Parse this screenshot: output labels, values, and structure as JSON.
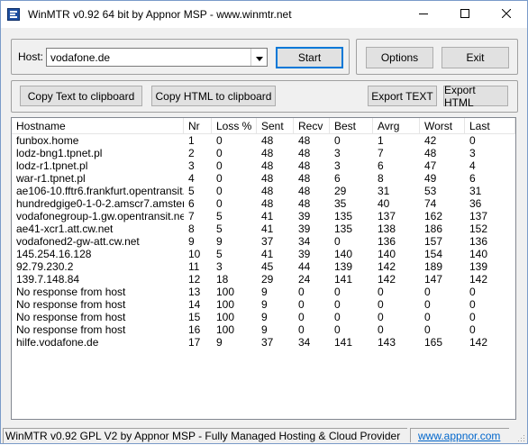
{
  "window": {
    "title": "WinMTR v0.92 64 bit by Appnor MSP - www.winmtr.net",
    "icon": "winmtr-app-icon",
    "controls": [
      "minimize-icon",
      "maximize-icon",
      "close-icon"
    ]
  },
  "host_group": {
    "label": "Host:",
    "value": "vodafone.de",
    "start_label": "Start"
  },
  "options_group": {
    "options_label": "Options",
    "exit_label": "Exit"
  },
  "toolbar": {
    "copy_text_label": "Copy Text to clipboard",
    "copy_html_label": "Copy HTML to clipboard",
    "export_text_label": "Export TEXT",
    "export_html_label": "Export HTML"
  },
  "table": {
    "columns": [
      "Hostname",
      "Nr",
      "Loss %",
      "Sent",
      "Recv",
      "Best",
      "Avrg",
      "Worst",
      "Last"
    ],
    "rows": [
      [
        "funbox.home",
        "1",
        "0",
        "48",
        "48",
        "0",
        "1",
        "42",
        "0"
      ],
      [
        "lodz-bng1.tpnet.pl",
        "2",
        "0",
        "48",
        "48",
        "3",
        "7",
        "48",
        "3"
      ],
      [
        "lodz-r1.tpnet.pl",
        "3",
        "0",
        "48",
        "48",
        "3",
        "6",
        "47",
        "4"
      ],
      [
        "war-r1.tpnet.pl",
        "4",
        "0",
        "48",
        "48",
        "6",
        "8",
        "49",
        "6"
      ],
      [
        "ae106-10.fftr6.frankfurt.opentransit.net",
        "5",
        "0",
        "48",
        "48",
        "29",
        "31",
        "53",
        "31"
      ],
      [
        "hundredgige0-1-0-2.amscr7.amsterda...",
        "6",
        "0",
        "48",
        "48",
        "35",
        "40",
        "74",
        "36"
      ],
      [
        "vodafonegroup-1.gw.opentransit.net",
        "7",
        "5",
        "41",
        "39",
        "135",
        "137",
        "162",
        "137"
      ],
      [
        "ae41-xcr1.att.cw.net",
        "8",
        "5",
        "41",
        "39",
        "135",
        "138",
        "186",
        "152"
      ],
      [
        "vodafoned2-gw-att.cw.net",
        "9",
        "9",
        "37",
        "34",
        "0",
        "136",
        "157",
        "136"
      ],
      [
        "145.254.16.128",
        "10",
        "5",
        "41",
        "39",
        "140",
        "140",
        "154",
        "140"
      ],
      [
        "92.79.230.2",
        "11",
        "3",
        "45",
        "44",
        "139",
        "142",
        "189",
        "139"
      ],
      [
        "139.7.148.84",
        "12",
        "18",
        "29",
        "24",
        "141",
        "142",
        "147",
        "142"
      ],
      [
        "No response from host",
        "13",
        "100",
        "9",
        "0",
        "0",
        "0",
        "0",
        "0"
      ],
      [
        "No response from host",
        "14",
        "100",
        "9",
        "0",
        "0",
        "0",
        "0",
        "0"
      ],
      [
        "No response from host",
        "15",
        "100",
        "9",
        "0",
        "0",
        "0",
        "0",
        "0"
      ],
      [
        "No response from host",
        "16",
        "100",
        "9",
        "0",
        "0",
        "0",
        "0",
        "0"
      ],
      [
        "hilfe.vodafone.de",
        "17",
        "9",
        "37",
        "34",
        "141",
        "143",
        "165",
        "142"
      ]
    ]
  },
  "status": {
    "text": "WinMTR v0.92 GPL V2 by Appnor MSP - Fully Managed Hosting & Cloud Provider",
    "link": "www.appnor.com"
  }
}
